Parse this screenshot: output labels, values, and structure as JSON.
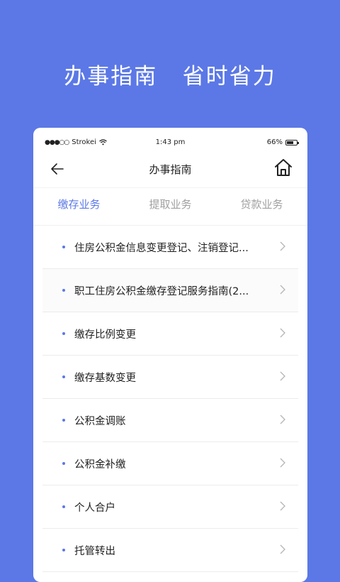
{
  "banner": {
    "headline": "办事指南   省时省力"
  },
  "status_bar": {
    "signal_dots": "●●●○○",
    "carrier": "Strokei",
    "time": "1:43 pm",
    "battery_text": "66%",
    "battery_level": 0.66
  },
  "nav": {
    "title": "办事指南"
  },
  "tabs": [
    {
      "label": "缴存业务",
      "active": true
    },
    {
      "label": "提取业务",
      "active": false
    },
    {
      "label": "贷款业务",
      "active": false
    }
  ],
  "list": [
    {
      "label": "住房公积金信息变更登记、注销登记..."
    },
    {
      "label": "职工住房公积金缴存登记服务指南(2..."
    },
    {
      "label": "缴存比例变更"
    },
    {
      "label": "缴存基数变更"
    },
    {
      "label": "公积金调账"
    },
    {
      "label": "公积金补缴"
    },
    {
      "label": "个人合户"
    },
    {
      "label": "托管转出"
    }
  ],
  "colors": {
    "accent": "#5b78e6",
    "background": "#5b78e6",
    "card": "#ffffff"
  }
}
